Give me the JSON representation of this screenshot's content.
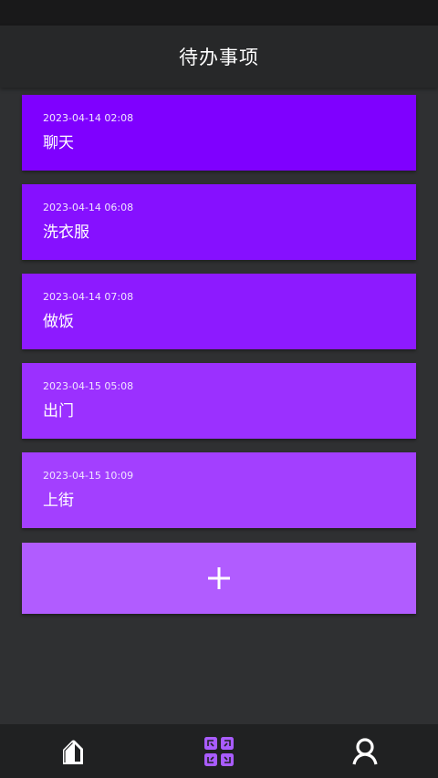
{
  "header": {
    "title": "待办事项"
  },
  "todos": [
    {
      "time": "2023-04-14 02:08",
      "text": "聊天",
      "color": "#7f00ff"
    },
    {
      "time": "2023-04-14 06:08",
      "text": "洗衣服",
      "color": "#8610ff"
    },
    {
      "time": "2023-04-14 07:08",
      "text": "做饭",
      "color": "#8d1aff"
    },
    {
      "time": "2023-04-15 05:08",
      "text": "出门",
      "color": "#9b30ff"
    },
    {
      "time": "2023-04-15 10:09",
      "text": "上街",
      "color": "#a33fff"
    }
  ],
  "add_button": {
    "icon": "plus-icon",
    "color": "#b15cff"
  },
  "bottom_nav": [
    {
      "name": "home",
      "icon": "home-icon",
      "active": false
    },
    {
      "name": "todo",
      "icon": "grid-icon",
      "active": true,
      "accent": "#a95cff"
    },
    {
      "name": "profile",
      "icon": "user-icon",
      "active": false
    }
  ]
}
